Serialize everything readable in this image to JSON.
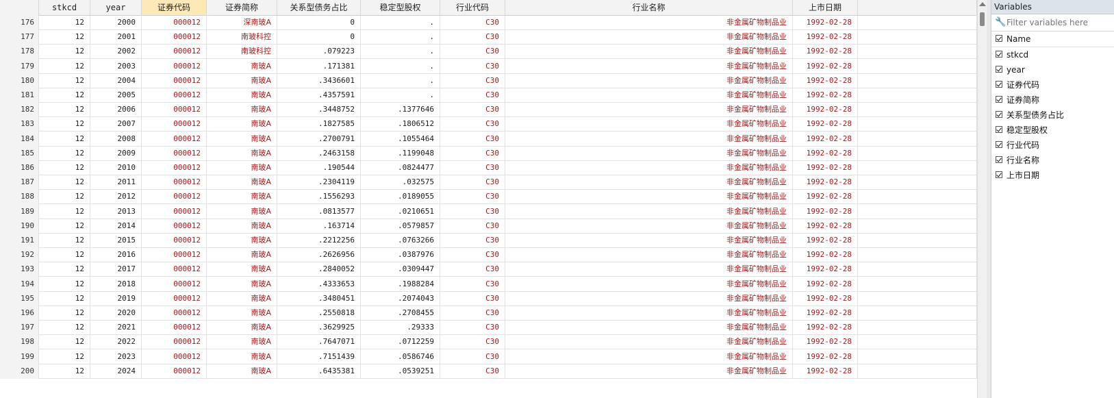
{
  "grid": {
    "columns": [
      {
        "key": "rn",
        "label": "",
        "width": 57
      },
      {
        "key": "stkcd",
        "label": "stkcd",
        "width": 75
      },
      {
        "key": "year",
        "label": "year",
        "width": 75
      },
      {
        "key": "code",
        "label": "证券代码",
        "width": 95,
        "selected": true
      },
      {
        "key": "abbr",
        "label": "证券简称",
        "width": 103
      },
      {
        "key": "debt",
        "label": "关系型债务占比",
        "width": 122
      },
      {
        "key": "equity",
        "label": "稳定型股权",
        "width": 116
      },
      {
        "key": "indcode",
        "label": "行业代码",
        "width": 95
      },
      {
        "key": "indname",
        "label": "行业名称",
        "width": 420
      },
      {
        "key": "listdate",
        "label": "上市日期",
        "width": 95
      },
      {
        "key": "extra",
        "label": "",
        "width": 174
      }
    ],
    "rows": [
      [
        "176",
        "12",
        "2000",
        "000012",
        "深南玻A",
        "0",
        ".",
        "C30",
        "非金属矿物制品业",
        "1992-02-28",
        ""
      ],
      [
        "177",
        "12",
        "2001",
        "000012",
        "南玻科控",
        "0",
        ".",
        "C30",
        "非金属矿物制品业",
        "1992-02-28",
        ""
      ],
      [
        "178",
        "12",
        "2002",
        "000012",
        "南玻科控",
        ".079223",
        ".",
        "C30",
        "非金属矿物制品业",
        "1992-02-28",
        ""
      ],
      [
        "179",
        "12",
        "2003",
        "000012",
        "南玻A",
        ".171381",
        ".",
        "C30",
        "非金属矿物制品业",
        "1992-02-28",
        ""
      ],
      [
        "180",
        "12",
        "2004",
        "000012",
        "南玻A",
        ".3436601",
        ".",
        "C30",
        "非金属矿物制品业",
        "1992-02-28",
        ""
      ],
      [
        "181",
        "12",
        "2005",
        "000012",
        "南玻A",
        ".4357591",
        ".",
        "C30",
        "非金属矿物制品业",
        "1992-02-28",
        ""
      ],
      [
        "182",
        "12",
        "2006",
        "000012",
        "南玻A",
        ".3448752",
        ".1377646",
        "C30",
        "非金属矿物制品业",
        "1992-02-28",
        ""
      ],
      [
        "183",
        "12",
        "2007",
        "000012",
        "南玻A",
        ".1827585",
        ".1806512",
        "C30",
        "非金属矿物制品业",
        "1992-02-28",
        ""
      ],
      [
        "184",
        "12",
        "2008",
        "000012",
        "南玻A",
        ".2700791",
        ".1055464",
        "C30",
        "非金属矿物制品业",
        "1992-02-28",
        ""
      ],
      [
        "185",
        "12",
        "2009",
        "000012",
        "南玻A",
        ".2463158",
        ".1199048",
        "C30",
        "非金属矿物制品业",
        "1992-02-28",
        ""
      ],
      [
        "186",
        "12",
        "2010",
        "000012",
        "南玻A",
        ".190544",
        ".0824477",
        "C30",
        "非金属矿物制品业",
        "1992-02-28",
        ""
      ],
      [
        "187",
        "12",
        "2011",
        "000012",
        "南玻A",
        ".2304119",
        ".032575",
        "C30",
        "非金属矿物制品业",
        "1992-02-28",
        ""
      ],
      [
        "188",
        "12",
        "2012",
        "000012",
        "南玻A",
        ".1556293",
        ".0189055",
        "C30",
        "非金属矿物制品业",
        "1992-02-28",
        ""
      ],
      [
        "189",
        "12",
        "2013",
        "000012",
        "南玻A",
        ".0813577",
        ".0210651",
        "C30",
        "非金属矿物制品业",
        "1992-02-28",
        ""
      ],
      [
        "190",
        "12",
        "2014",
        "000012",
        "南玻A",
        ".163714",
        ".0579857",
        "C30",
        "非金属矿物制品业",
        "1992-02-28",
        ""
      ],
      [
        "191",
        "12",
        "2015",
        "000012",
        "南玻A",
        ".2212256",
        ".0763266",
        "C30",
        "非金属矿物制品业",
        "1992-02-28",
        ""
      ],
      [
        "192",
        "12",
        "2016",
        "000012",
        "南玻A",
        ".2626956",
        ".0387976",
        "C30",
        "非金属矿物制品业",
        "1992-02-28",
        ""
      ],
      [
        "193",
        "12",
        "2017",
        "000012",
        "南玻A",
        ".2840052",
        ".0309447",
        "C30",
        "非金属矿物制品业",
        "1992-02-28",
        ""
      ],
      [
        "194",
        "12",
        "2018",
        "000012",
        "南玻A",
        ".4333653",
        ".1988284",
        "C30",
        "非金属矿物制品业",
        "1992-02-28",
        ""
      ],
      [
        "195",
        "12",
        "2019",
        "000012",
        "南玻A",
        ".3480451",
        ".2074043",
        "C30",
        "非金属矿物制品业",
        "1992-02-28",
        ""
      ],
      [
        "196",
        "12",
        "2020",
        "000012",
        "南玻A",
        ".2550818",
        ".2708455",
        "C30",
        "非金属矿物制品业",
        "1992-02-28",
        ""
      ],
      [
        "197",
        "12",
        "2021",
        "000012",
        "南玻A",
        ".3629925",
        ".29333",
        "C30",
        "非金属矿物制品业",
        "1992-02-28",
        ""
      ],
      [
        "198",
        "12",
        "2022",
        "000012",
        "南玻A",
        ".7647071",
        ".0712259",
        "C30",
        "非金属矿物制品业",
        "1992-02-28",
        ""
      ],
      [
        "199",
        "12",
        "2023",
        "000012",
        "南玻A",
        ".7151439",
        ".0586746",
        "C30",
        "非金属矿物制品业",
        "1992-02-28",
        ""
      ],
      [
        "200",
        "12",
        "2024",
        "000012",
        "南玻A",
        ".6435381",
        ".0539251",
        "C30",
        "非金属矿物制品业",
        "1992-02-28",
        ""
      ]
    ]
  },
  "variables": {
    "title": "Variables",
    "filter_placeholder": "Filter variables here",
    "name_header": "Name",
    "items": [
      "stkcd",
      "year",
      "证券代码",
      "证券简称",
      "关系型债务占比",
      "稳定型股权",
      "行业代码",
      "行业名称",
      "上市日期"
    ]
  },
  "colors": {
    "string_text": "#a1191b",
    "selected_header": "#fde9b8",
    "panel_title": "#dde3ea"
  },
  "icons": {
    "filter": "wrench-icon",
    "checkbox": "checkbox-checked-icon"
  }
}
